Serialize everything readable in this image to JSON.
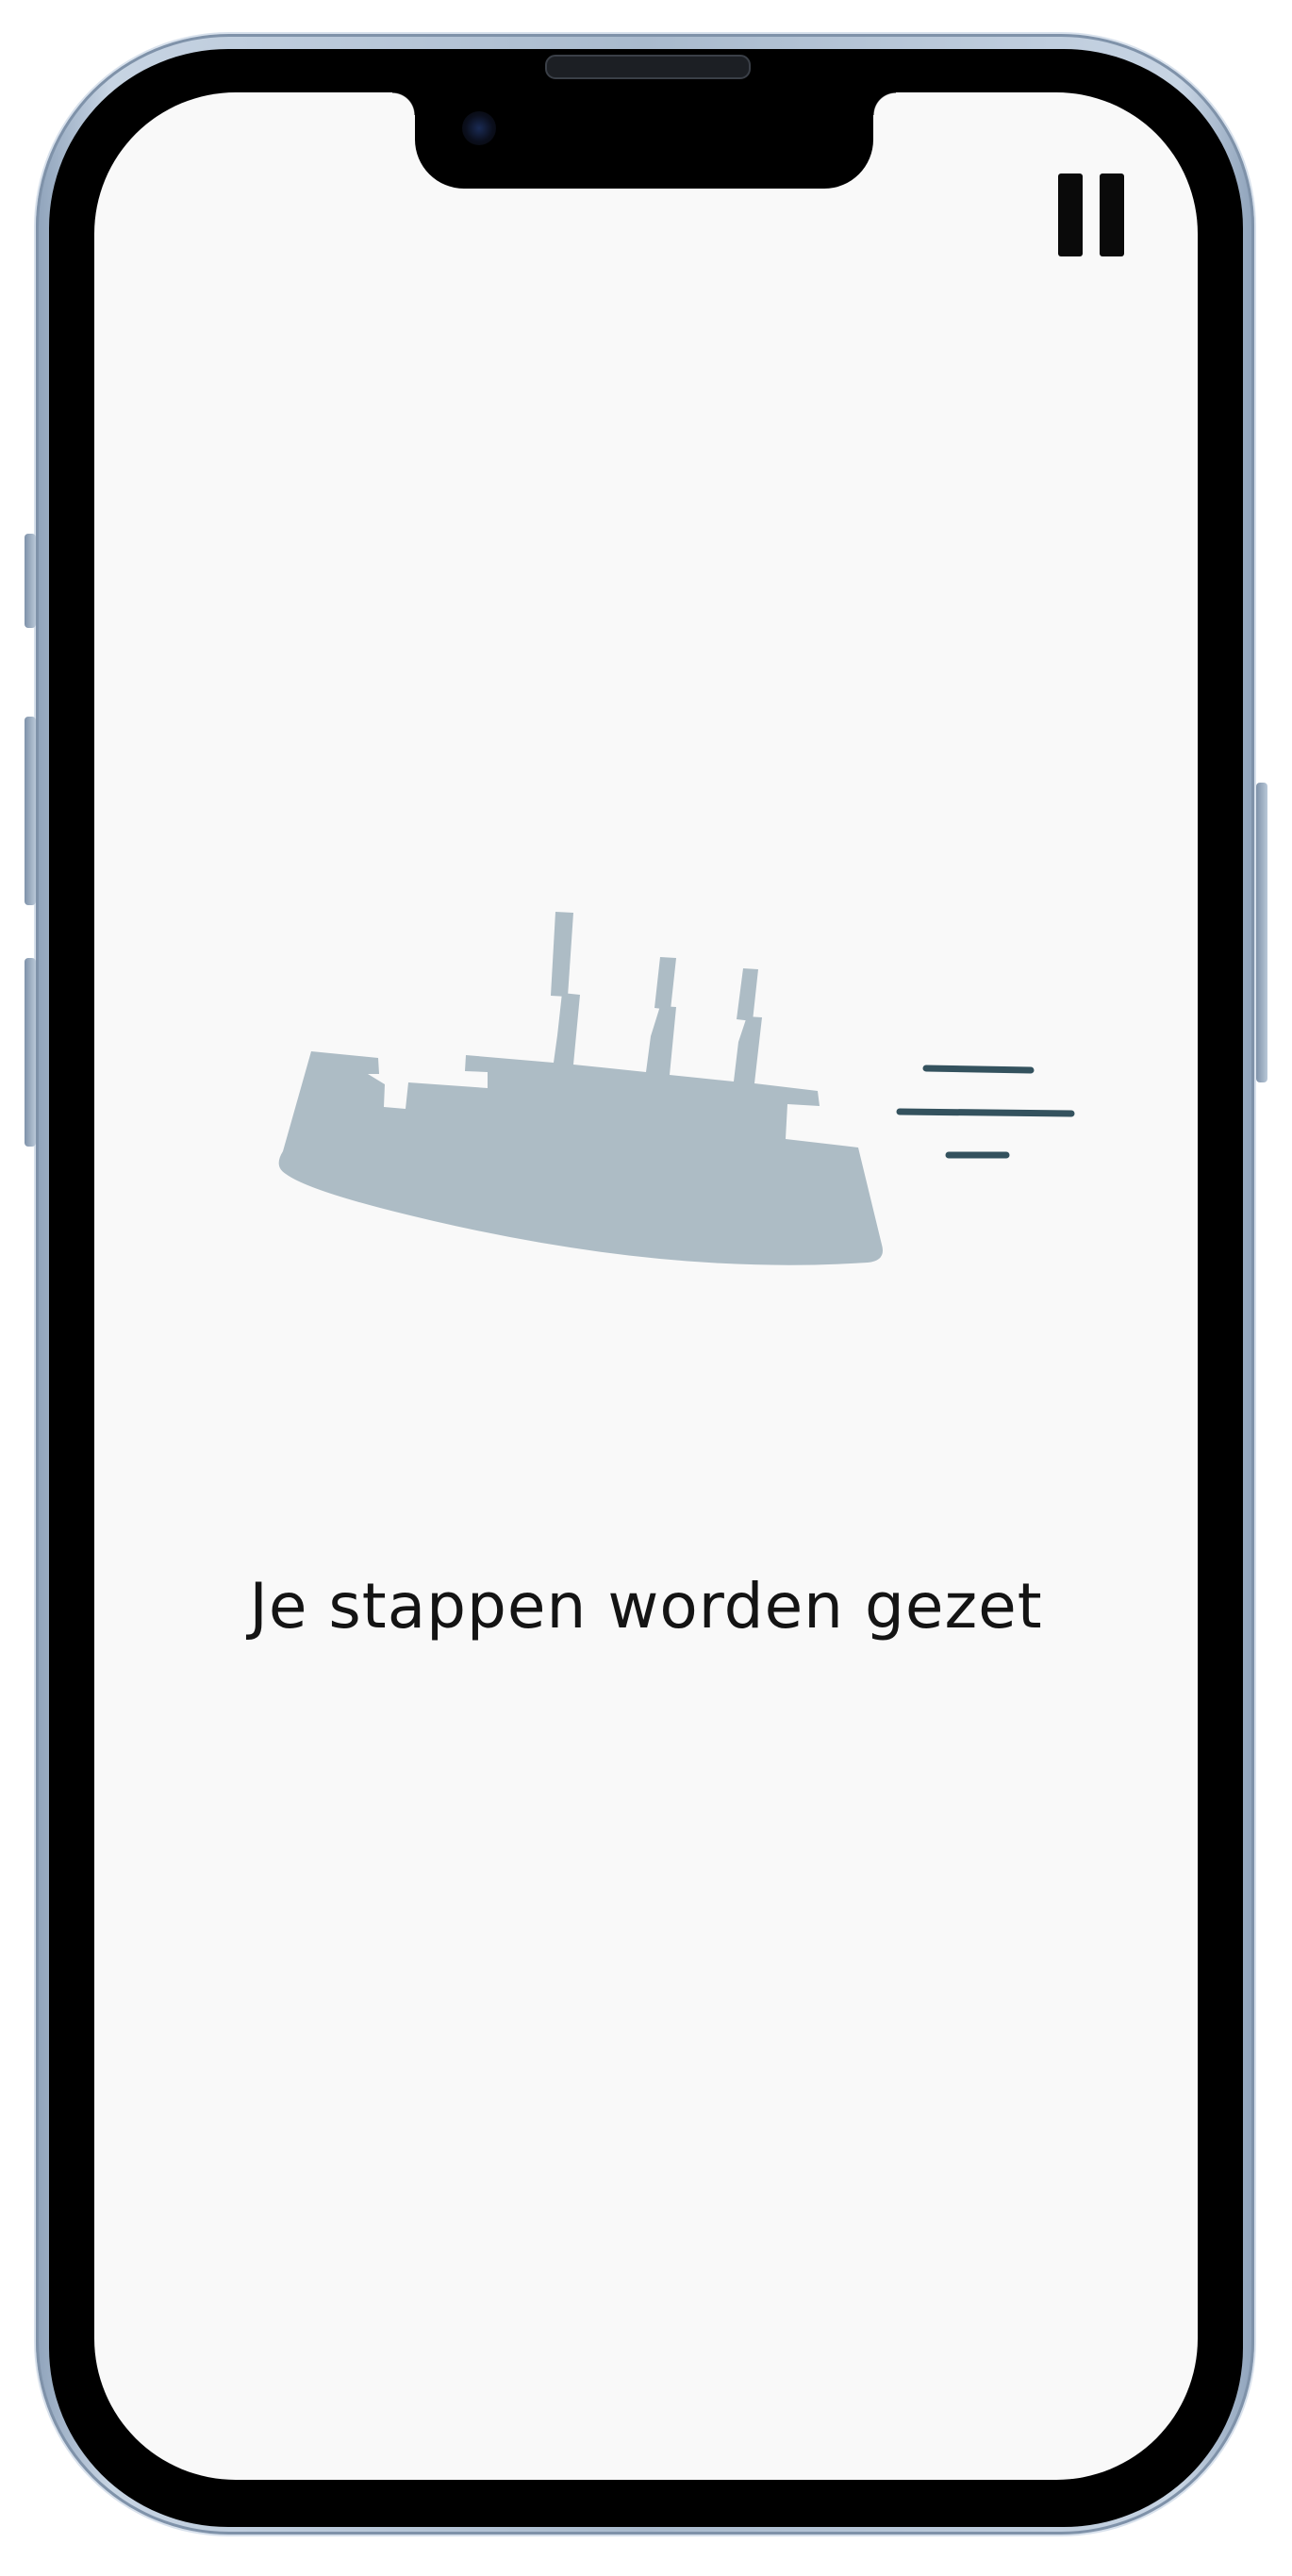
{
  "app": {
    "screen": "loading",
    "background_color": "#f9f9f9"
  },
  "controls": {
    "pause_icon": "pause-icon"
  },
  "illustration": {
    "icon": "moving-ship-icon",
    "ship_color": "#adbcc5",
    "motion_lines_color": "#34525e"
  },
  "message": {
    "text": "Je stappen worden gezet"
  }
}
